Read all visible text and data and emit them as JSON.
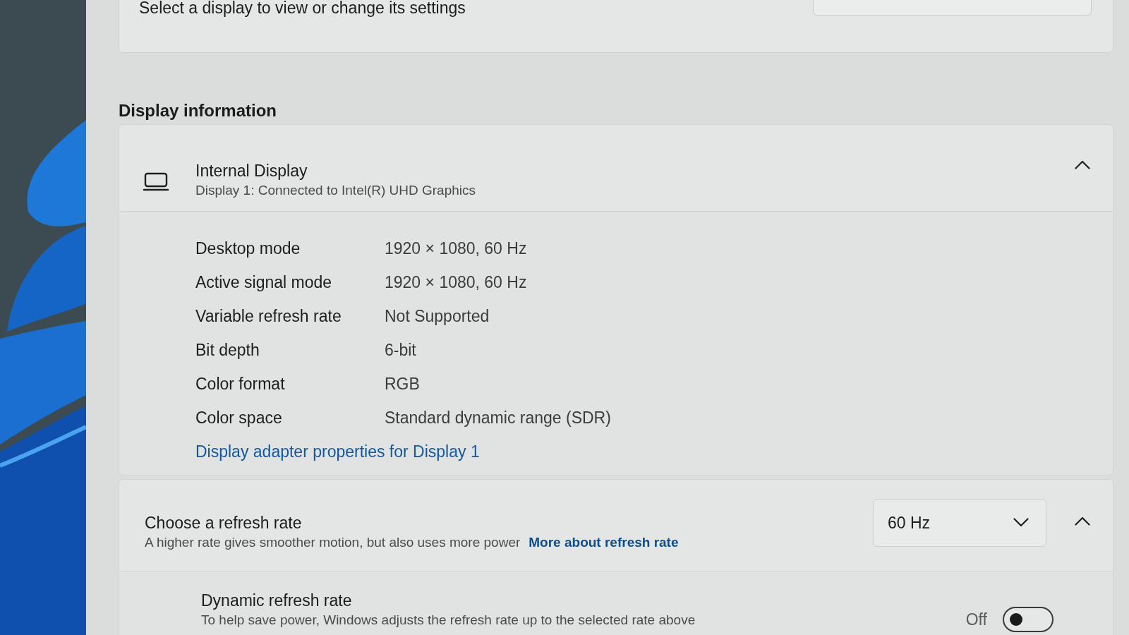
{
  "display_selector": {
    "label": "Select a display to view or change its settings"
  },
  "section_title": "Display information",
  "display_info": {
    "title": "Internal Display",
    "subtitle": "Display 1: Connected to Intel(R) UHD Graphics",
    "expanded": true,
    "properties": [
      {
        "label": "Desktop mode",
        "value": "1920 × 1080, 60 Hz"
      },
      {
        "label": "Active signal mode",
        "value": "1920 × 1080, 60 Hz"
      },
      {
        "label": "Variable refresh rate",
        "value": "Not Supported"
      },
      {
        "label": "Bit depth",
        "value": "6-bit"
      },
      {
        "label": "Color format",
        "value": "RGB"
      },
      {
        "label": "Color space",
        "value": "Standard dynamic range (SDR)"
      }
    ],
    "link": "Display adapter properties for Display 1"
  },
  "refresh_rate": {
    "title": "Choose a refresh rate",
    "description": "A higher rate gives smoother motion, but also uses more power",
    "link": "More about refresh rate",
    "dropdown": {
      "value": "60 Hz"
    },
    "expanded": true,
    "dynamic_refresh": {
      "title": "Dynamic refresh rate",
      "description": "To help save power, Windows adjusts the refresh rate up to the selected rate above",
      "state_label": "Off",
      "on": false
    }
  }
}
